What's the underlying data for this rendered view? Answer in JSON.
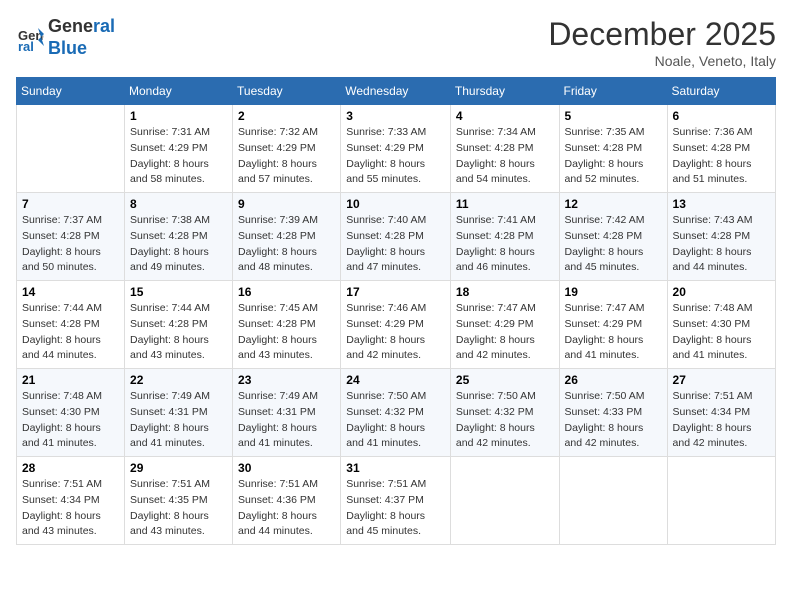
{
  "header": {
    "logo_line1": "General",
    "logo_line2": "Blue",
    "month_title": "December 2025",
    "location": "Noale, Veneto, Italy"
  },
  "days_of_week": [
    "Sunday",
    "Monday",
    "Tuesday",
    "Wednesday",
    "Thursday",
    "Friday",
    "Saturday"
  ],
  "weeks": [
    [
      {
        "num": "",
        "sunrise": "",
        "sunset": "",
        "daylight": "",
        "empty": true
      },
      {
        "num": "1",
        "sunrise": "7:31 AM",
        "sunset": "4:29 PM",
        "daylight": "8 hours and 58 minutes."
      },
      {
        "num": "2",
        "sunrise": "7:32 AM",
        "sunset": "4:29 PM",
        "daylight": "8 hours and 57 minutes."
      },
      {
        "num": "3",
        "sunrise": "7:33 AM",
        "sunset": "4:29 PM",
        "daylight": "8 hours and 55 minutes."
      },
      {
        "num": "4",
        "sunrise": "7:34 AM",
        "sunset": "4:28 PM",
        "daylight": "8 hours and 54 minutes."
      },
      {
        "num": "5",
        "sunrise": "7:35 AM",
        "sunset": "4:28 PM",
        "daylight": "8 hours and 52 minutes."
      },
      {
        "num": "6",
        "sunrise": "7:36 AM",
        "sunset": "4:28 PM",
        "daylight": "8 hours and 51 minutes."
      }
    ],
    [
      {
        "num": "7",
        "sunrise": "7:37 AM",
        "sunset": "4:28 PM",
        "daylight": "8 hours and 50 minutes."
      },
      {
        "num": "8",
        "sunrise": "7:38 AM",
        "sunset": "4:28 PM",
        "daylight": "8 hours and 49 minutes."
      },
      {
        "num": "9",
        "sunrise": "7:39 AM",
        "sunset": "4:28 PM",
        "daylight": "8 hours and 48 minutes."
      },
      {
        "num": "10",
        "sunrise": "7:40 AM",
        "sunset": "4:28 PM",
        "daylight": "8 hours and 47 minutes."
      },
      {
        "num": "11",
        "sunrise": "7:41 AM",
        "sunset": "4:28 PM",
        "daylight": "8 hours and 46 minutes."
      },
      {
        "num": "12",
        "sunrise": "7:42 AM",
        "sunset": "4:28 PM",
        "daylight": "8 hours and 45 minutes."
      },
      {
        "num": "13",
        "sunrise": "7:43 AM",
        "sunset": "4:28 PM",
        "daylight": "8 hours and 44 minutes."
      }
    ],
    [
      {
        "num": "14",
        "sunrise": "7:44 AM",
        "sunset": "4:28 PM",
        "daylight": "8 hours and 44 minutes."
      },
      {
        "num": "15",
        "sunrise": "7:44 AM",
        "sunset": "4:28 PM",
        "daylight": "8 hours and 43 minutes."
      },
      {
        "num": "16",
        "sunrise": "7:45 AM",
        "sunset": "4:28 PM",
        "daylight": "8 hours and 43 minutes."
      },
      {
        "num": "17",
        "sunrise": "7:46 AM",
        "sunset": "4:29 PM",
        "daylight": "8 hours and 42 minutes."
      },
      {
        "num": "18",
        "sunrise": "7:47 AM",
        "sunset": "4:29 PM",
        "daylight": "8 hours and 42 minutes."
      },
      {
        "num": "19",
        "sunrise": "7:47 AM",
        "sunset": "4:29 PM",
        "daylight": "8 hours and 41 minutes."
      },
      {
        "num": "20",
        "sunrise": "7:48 AM",
        "sunset": "4:30 PM",
        "daylight": "8 hours and 41 minutes."
      }
    ],
    [
      {
        "num": "21",
        "sunrise": "7:48 AM",
        "sunset": "4:30 PM",
        "daylight": "8 hours and 41 minutes."
      },
      {
        "num": "22",
        "sunrise": "7:49 AM",
        "sunset": "4:31 PM",
        "daylight": "8 hours and 41 minutes."
      },
      {
        "num": "23",
        "sunrise": "7:49 AM",
        "sunset": "4:31 PM",
        "daylight": "8 hours and 41 minutes."
      },
      {
        "num": "24",
        "sunrise": "7:50 AM",
        "sunset": "4:32 PM",
        "daylight": "8 hours and 41 minutes."
      },
      {
        "num": "25",
        "sunrise": "7:50 AM",
        "sunset": "4:32 PM",
        "daylight": "8 hours and 42 minutes."
      },
      {
        "num": "26",
        "sunrise": "7:50 AM",
        "sunset": "4:33 PM",
        "daylight": "8 hours and 42 minutes."
      },
      {
        "num": "27",
        "sunrise": "7:51 AM",
        "sunset": "4:34 PM",
        "daylight": "8 hours and 42 minutes."
      }
    ],
    [
      {
        "num": "28",
        "sunrise": "7:51 AM",
        "sunset": "4:34 PM",
        "daylight": "8 hours and 43 minutes."
      },
      {
        "num": "29",
        "sunrise": "7:51 AM",
        "sunset": "4:35 PM",
        "daylight": "8 hours and 43 minutes."
      },
      {
        "num": "30",
        "sunrise": "7:51 AM",
        "sunset": "4:36 PM",
        "daylight": "8 hours and 44 minutes."
      },
      {
        "num": "31",
        "sunrise": "7:51 AM",
        "sunset": "4:37 PM",
        "daylight": "8 hours and 45 minutes."
      },
      {
        "num": "",
        "sunrise": "",
        "sunset": "",
        "daylight": "",
        "empty": true
      },
      {
        "num": "",
        "sunrise": "",
        "sunset": "",
        "daylight": "",
        "empty": true
      },
      {
        "num": "",
        "sunrise": "",
        "sunset": "",
        "daylight": "",
        "empty": true
      }
    ]
  ],
  "labels": {
    "sunrise": "Sunrise:",
    "sunset": "Sunset:",
    "daylight": "Daylight:"
  }
}
